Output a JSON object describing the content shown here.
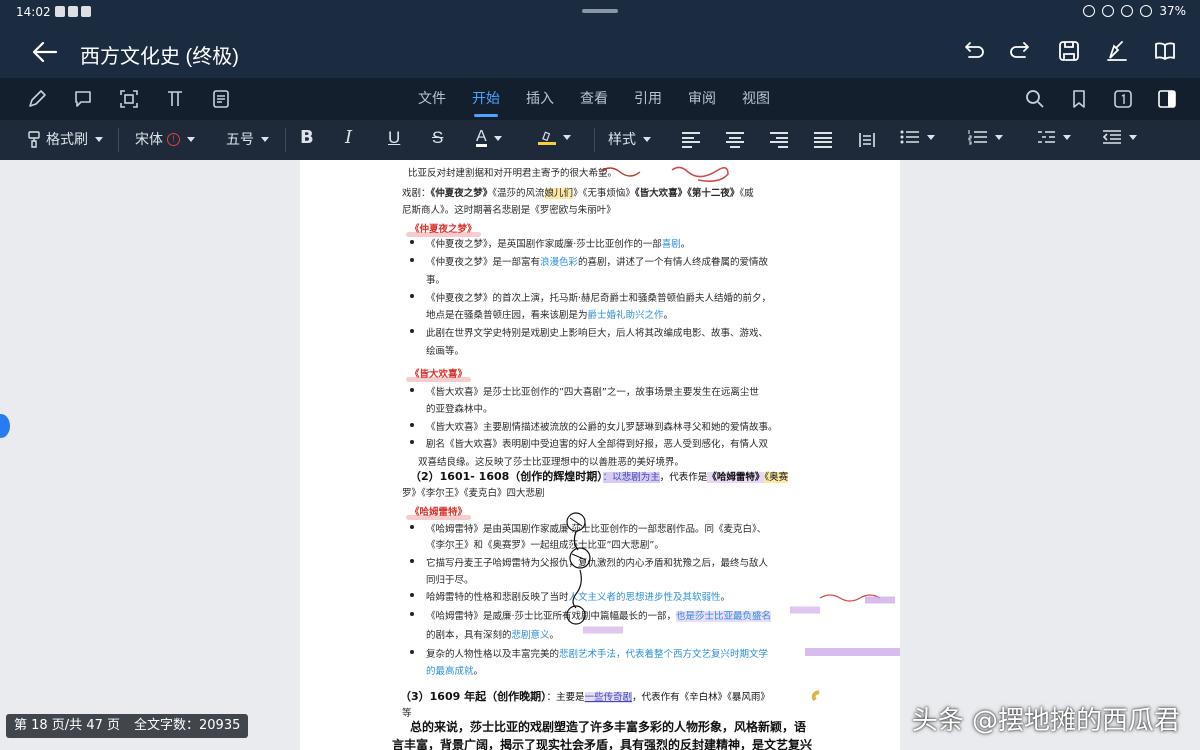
{
  "status": {
    "time": "14:02",
    "battery": "37%"
  },
  "title": {
    "doc_name": "西方文化史 (终极)"
  },
  "menu": {
    "tabs": [
      "文件",
      "开始",
      "插入",
      "查看",
      "引用",
      "审阅",
      "视图"
    ],
    "active": "开始"
  },
  "toolbar": {
    "format_painter": "格式刷",
    "font": "宋体",
    "size": "五号",
    "style": "样式",
    "font_color_glyph": "A"
  },
  "doc": {
    "line1": "比亚反对封建割据和对开明君主寄予的很大希望。",
    "drama_a": "戏剧：",
    "drama_b": "《仲夏夜之梦》",
    "drama_c": "《温莎的风流",
    "drama_d": "娘儿们",
    "drama_e": "》《无事烦恼》",
    "drama_f": "《皆大欢喜》《第十二夜》",
    "drama_g": "《威",
    "drama2": "尼斯商人》。这时期著名悲剧是《罗密欧与朱丽叶》",
    "h_mid": "《仲夏夜之梦》",
    "m1a": "《仲夏夜之梦》，是英国剧作家威廉·莎士比亚创作的一部",
    "m1b": "喜剧",
    "m1c": "。",
    "m2a": "《仲夏夜之梦》是一部富有",
    "m2b": "浪漫色彩",
    "m2c": "的喜剧，讲述了一个有情人终成眷属的爱情故",
    "m2d": "事。",
    "m3a": "《仲夏夜之梦》的首次上演，托马斯·赫尼奇爵士和骚桑普顿伯爵夫人结婚的前夕，",
    "m3b": "地点是在骚桑普顿庄园，看来该剧是为",
    "m3c": "爵士婚礼助兴之作",
    "m3d": "。",
    "m4a": "此剧在世界文学史特别是戏剧史上影响巨大，后人将其改编成电影、故事、游戏、",
    "m4b": "绘画等。",
    "h_as": "《皆大欢喜》",
    "a1a": "《皆大欢喜》是莎士比亚创作的”四大喜剧”之一，故事场景主要发生在远离尘世",
    "a1b": "的亚登森林中。",
    "a2": "《皆大欢喜》主要剧情描述被流放的公爵的女儿罗瑟琳到森林寻父和她的爱情故事。",
    "a3a": "剧名《皆大欢喜》表明剧中受迫害的好人全部得到好报，恶人受到感化，有情人双",
    "a3b": "双喜结良缘。这反映了莎士比亚理想中的以善胜恶的美好境界。",
    "s2a": "（2）1601- 1608（创作的辉煌时期）",
    "s2b": "：以悲剧为主",
    "s2c": "，代表作是",
    "s2d": "《哈姆雷特》",
    "s2e": "《奥赛",
    "s2f": "罗》《李尔王》《麦克白》四大悲剧",
    "h_ham": "《哈姆雷特》",
    "h1a": "《哈姆雷特》是由英国剧作家威廉·莎士比亚创作的一部悲剧作品。同《麦克白》、",
    "h1b": "《李尔王》和《奥赛罗》一起组成莎士比亚”四大悲剧”。",
    "h2a": "它描写丹麦王子哈姆雷特为父报仇，复仇激烈的内心矛盾和犹豫之后，最终与敌人",
    "h2b": "同归于尽。",
    "h3a": "哈姆雷特的性格和悲剧反映了当时",
    "h3b": "人文主义者的思想进步性及其软弱性",
    "h3c": "。",
    "h4a": "《哈姆雷特》是威廉·莎士比亚所有戏剧中篇幅最长的一部，",
    "h4b": "也是莎士比亚最负盛名",
    "h4c": "的剧本，具有深刻的",
    "h4d": "悲剧意义",
    "h4e": "。",
    "h5a": "复杂的人物性格以及丰富完美的",
    "h5b": "悲剧艺术手法，代表着整个西方文艺复兴时期文学",
    "h5c": "的最高成就",
    "h5d": "。",
    "s3a": "（3）1609 年起（创作晚期）",
    "s3b": "：主要是",
    "s3c": "一些传奇剧",
    "s3d": "，代表作有《辛白林》《暴风雨》",
    "s3e": "等",
    "p1": "总的来说，莎士比亚的戏剧塑造了许多丰富多彩的人物形象，风格新颖，语",
    "p2": "言丰富，背景广阔，揭示了现实社会矛盾，具有强烈的反封建精神，是文艺复兴"
  },
  "footer": {
    "page_label": "第 18 页/共 47 页",
    "word_count": "全文字数：20935"
  },
  "watermark": "头条 @摆地摊的西瓜君",
  "colors": {
    "title_bar": "#1b2b40",
    "menu_bar": "#141f2e",
    "toolbar": "#1e2a3a",
    "accent": "#4ea3ff",
    "heading_red": "#d8332b",
    "link_blue": "#2e8fd8"
  }
}
